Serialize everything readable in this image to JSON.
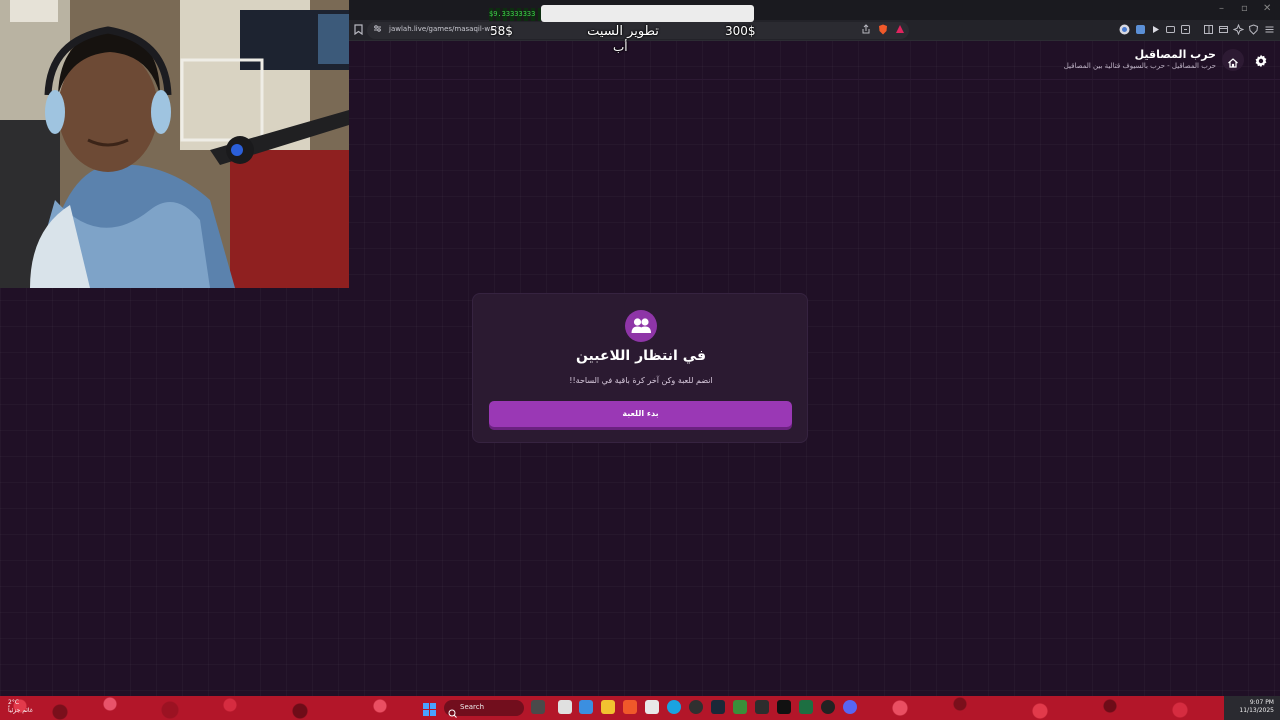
{
  "browser": {
    "url": "jawlah.live/games/masaqil-war?c",
    "minimize": "–",
    "restore": "▫",
    "close": "✕"
  },
  "stream_overlay": {
    "ticker": "$9.33333333",
    "amount_left": "58$",
    "goal_title_line1": "تطوير السيت",
    "goal_title_line2": "أب",
    "amount_right": "300$"
  },
  "site": {
    "title": "حرب المصاقيل",
    "subtitle": "حرب المصاقيل - حرب بالسيوف قتالية بين المصاقيل"
  },
  "waiting_card": {
    "title": "في انتظار اللاعبين",
    "subtitle": "انضم للعبة وكن آخر كرة باقية في الساحة!!",
    "start_button": "بدء اللعبة"
  },
  "taskbar": {
    "weather_temp": "2°C",
    "weather_desc": "غائم جزئياً",
    "search_placeholder": "Search",
    "time": "9:07 PM",
    "date": "11/13/2025"
  },
  "colors": {
    "page_bg": "#201026",
    "card_bg": "#2b1a31",
    "accent": "#9a38b5"
  }
}
